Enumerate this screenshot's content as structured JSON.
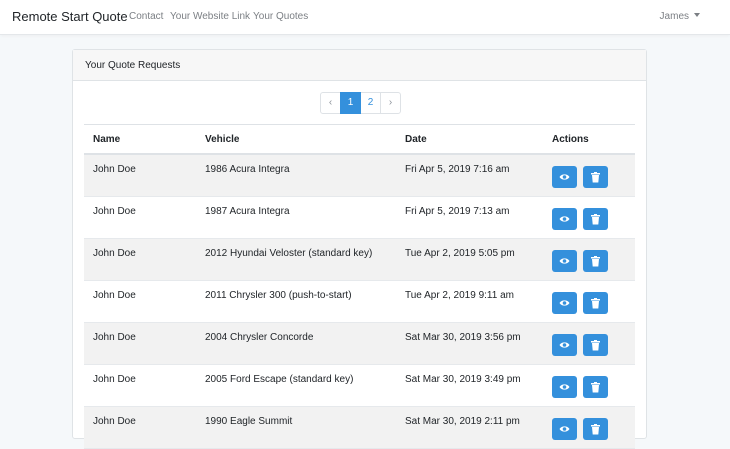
{
  "navbar": {
    "brand": "Remote Start Quote",
    "links": [
      "Contact",
      "Your Website Link",
      "Your Quotes"
    ],
    "user": "James"
  },
  "card": {
    "title": "Your Quote Requests"
  },
  "pagination": {
    "prev": "‹",
    "pages": [
      "1",
      "2"
    ],
    "next": "›",
    "current": "1"
  },
  "table": {
    "headers": [
      "Name",
      "Vehicle",
      "Date",
      "Actions"
    ],
    "rows": [
      {
        "name": "John Doe",
        "vehicle": "1986 Acura Integra",
        "date": "Fri Apr 5, 2019 7:16 am"
      },
      {
        "name": "John Doe",
        "vehicle": "1987 Acura Integra",
        "date": "Fri Apr 5, 2019 7:13 am"
      },
      {
        "name": "John Doe",
        "vehicle": "2012 Hyundai Veloster (standard key)",
        "date": "Tue Apr 2, 2019 5:05 pm"
      },
      {
        "name": "John Doe",
        "vehicle": "2011 Chrysler 300 (push-to-start)",
        "date": "Tue Apr 2, 2019 9:11 am"
      },
      {
        "name": "John Doe",
        "vehicle": "2004 Chrysler Concorde",
        "date": "Sat Mar 30, 2019 3:56 pm"
      },
      {
        "name": "John Doe",
        "vehicle": "2005 Ford Escape (standard key)",
        "date": "Sat Mar 30, 2019 3:49 pm"
      },
      {
        "name": "John Doe",
        "vehicle": "1990 Eagle Summit",
        "date": "Sat Mar 30, 2019 2:11 pm"
      }
    ],
    "action_icons": [
      "eye-icon",
      "trash-icon"
    ]
  },
  "colors": {
    "primary": "#3490dc",
    "background": "#f5f8fa",
    "stripe": "#f2f2f2"
  }
}
